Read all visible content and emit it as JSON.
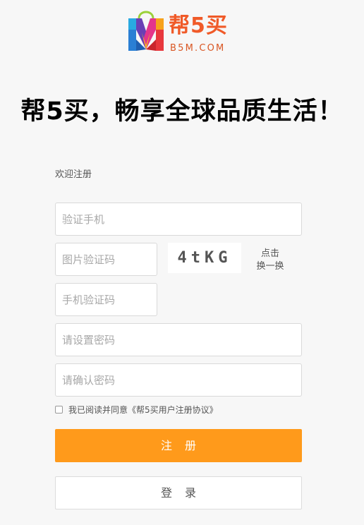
{
  "logo": {
    "brand_cn": "帮5买",
    "brand_en": "B5M.COM"
  },
  "slogan": "帮5买，畅享全球品质生活！",
  "form": {
    "welcome": "欢迎注册",
    "phone_placeholder": "验证手机",
    "captcha_placeholder": "图片验证码",
    "captcha_text": "4tKG",
    "refresh_line1": "点击",
    "refresh_line2": "换一换",
    "sms_placeholder": "手机验证码",
    "password_placeholder": "请设置密码",
    "confirm_placeholder": "请确认密码",
    "agree_prefix": "我已阅读并同意",
    "agree_link": "《帮5买用户注册协议》",
    "agree_checked": false,
    "register_label": "注册",
    "login_label": "登录"
  },
  "colors": {
    "brand_orange": "#f05a28",
    "button_orange": "#ff9a1b",
    "background": "#f7f7f7"
  }
}
